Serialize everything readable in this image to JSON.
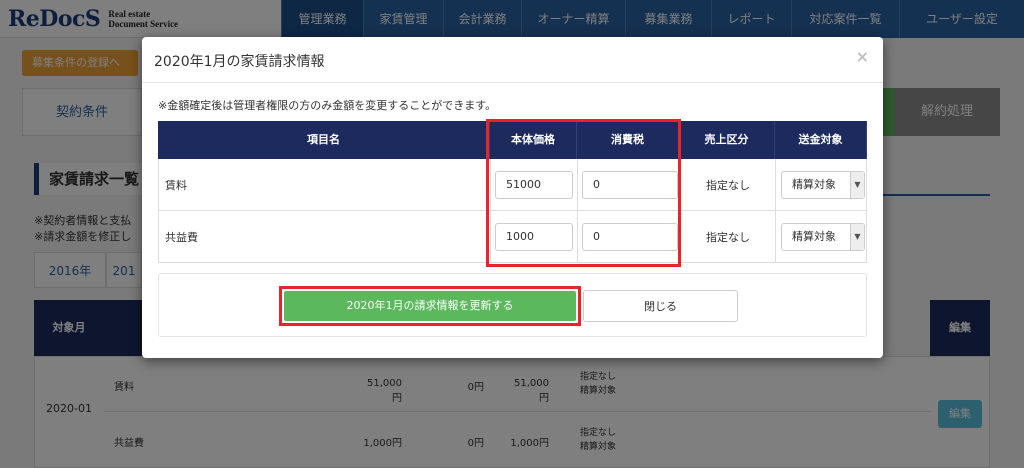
{
  "header": {
    "logo_main": "ReDocS",
    "logo_sub_line1": "Real estate",
    "logo_sub_line2": "Document Service",
    "nav": [
      {
        "label": "管理業務",
        "active": true
      },
      {
        "label": "家賃管理",
        "active": false
      },
      {
        "label": "会計業務",
        "active": false
      },
      {
        "label": "オーナー精算",
        "active": false
      },
      {
        "label": "募集業務",
        "active": false
      },
      {
        "label": "レポート",
        "active": false
      },
      {
        "label": "対応案件一覧",
        "active": false
      },
      {
        "label": "ユーザー設定",
        "active": false
      }
    ]
  },
  "background": {
    "recruit_button": "募集条件の登録へ",
    "tab_contract": "契約条件",
    "tab_cancel": "解約処理",
    "section_title": "家賃請求一覧",
    "note1": "※契約者情報と支払",
    "note2": "※請求金額を修正し",
    "years": [
      "2016年",
      "201"
    ],
    "table": {
      "th_month": "対象月",
      "th_edit": "編集",
      "month": "2020-01",
      "rows": [
        {
          "name": "賃料",
          "v1": "51,000円",
          "v2": "0円",
          "v3": "51,000円",
          "cls1": "指定なし",
          "cls2": "精算対象"
        },
        {
          "name": "共益費",
          "v1": "1,000円",
          "v2": "0円",
          "v3": "1,000円",
          "cls1": "指定なし",
          "cls2": "精算対象"
        }
      ],
      "edit_button": "編集"
    }
  },
  "modal": {
    "title": "2020年1月の家賃請求情報",
    "close_symbol": "×",
    "note": "※金額確定後は管理者権限の方のみ金額を変更することができます。",
    "headers": {
      "name": "項目名",
      "base": "本体価格",
      "tax": "消費税",
      "sales": "売上区分",
      "send": "送金対象"
    },
    "rows": [
      {
        "name": "賃料",
        "base": "51000",
        "tax": "0",
        "sales": "指定なし",
        "send": "精算対象"
      },
      {
        "name": "共益費",
        "base": "1000",
        "tax": "0",
        "sales": "指定なし",
        "send": "精算対象"
      }
    ],
    "update_button": "2020年1月の請求情報を更新する",
    "close_button": "閉じる"
  },
  "colors": {
    "nav_bg": "#2a62a3",
    "table_header": "#1d2a5e",
    "highlight": "#e8232b",
    "update_button": "#5cb85c"
  }
}
